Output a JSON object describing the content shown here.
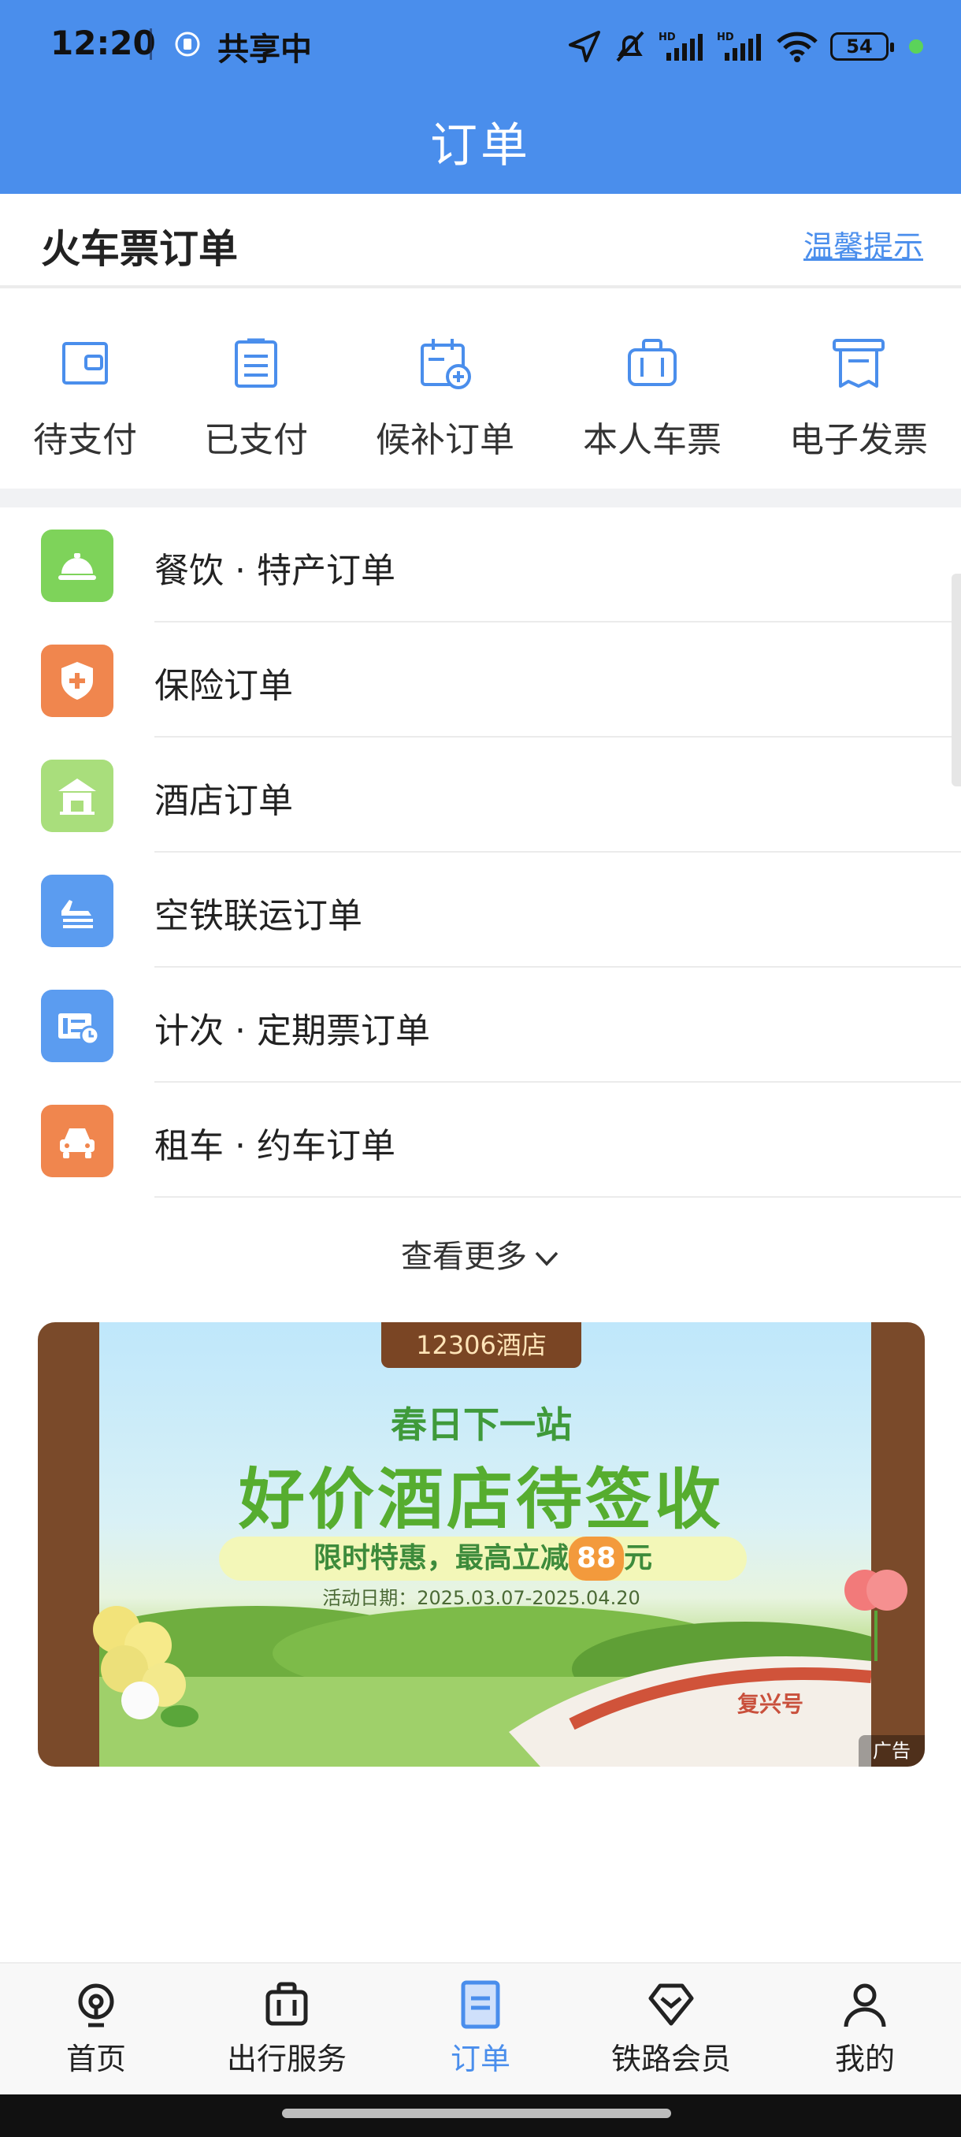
{
  "status_bar": {
    "time": "12:20",
    "share_text": "共享中",
    "battery": "54",
    "signal_hd_1": "HD",
    "signal_hd_2": "HD"
  },
  "header": {
    "title": "订单"
  },
  "train_orders": {
    "title": "火车票订单",
    "tips_link": "温馨提示",
    "actions": [
      {
        "label": "待支付",
        "icon": "wallet-icon"
      },
      {
        "label": "已支付",
        "icon": "clipboard-icon"
      },
      {
        "label": "候补订单",
        "icon": "calendar-plus-icon"
      },
      {
        "label": "本人车票",
        "icon": "luggage-icon"
      },
      {
        "label": "电子发票",
        "icon": "invoice-icon"
      }
    ]
  },
  "order_list": [
    {
      "label": "餐饮 · 特产订单",
      "icon": "service-bell-icon",
      "color": "#7ED35A"
    },
    {
      "label": "保险订单",
      "icon": "shield-plus-icon",
      "color": "#F0864E"
    },
    {
      "label": "酒店订单",
      "icon": "hotel-icon",
      "color": "#A9DE7C"
    },
    {
      "label": "空铁联运订单",
      "icon": "plane-train-icon",
      "color": "#5B9CF0"
    },
    {
      "label": "计次 · 定期票订单",
      "icon": "ticket-clock-icon",
      "color": "#5B9CF0"
    },
    {
      "label": "租车 · 约车订单",
      "icon": "car-icon",
      "color": "#F0864E"
    }
  ],
  "more_link": "查看更多",
  "banner": {
    "tag": "12306酒店",
    "line1": "春日下一站",
    "line2": "好价酒店待签收",
    "line3_prefix": "限时特惠，最高立减",
    "line3_num": "88",
    "line3_suffix": "元",
    "date": "活动日期：2025.03.07-2025.04.20",
    "train_text": "复兴号",
    "ad_label": "广告"
  },
  "bottom_nav": [
    {
      "label": "首页",
      "icon": "home-train-icon",
      "active": false
    },
    {
      "label": "出行服务",
      "icon": "luggage-icon",
      "active": false
    },
    {
      "label": "订单",
      "icon": "order-doc-icon",
      "active": true
    },
    {
      "label": "铁路会员",
      "icon": "diamond-icon",
      "active": false
    },
    {
      "label": "我的",
      "icon": "user-icon",
      "active": false
    }
  ],
  "colors": {
    "primary": "#4A8EEC"
  }
}
